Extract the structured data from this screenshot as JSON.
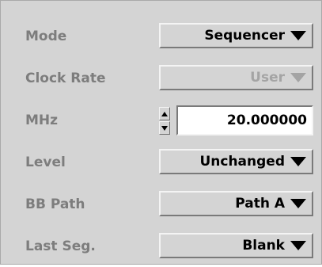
{
  "rows": [
    {
      "label": "Mode",
      "value": "Sequencer",
      "enabled": true
    },
    {
      "label": "Clock Rate",
      "value": "User",
      "enabled": false
    },
    {
      "label": "MHz",
      "value": "20.000000"
    },
    {
      "label": "Level",
      "value": "Unchanged",
      "enabled": true
    },
    {
      "label": "BB Path",
      "value": "Path A",
      "enabled": true
    },
    {
      "label": "Last Seg.",
      "value": "Blank",
      "enabled": true
    }
  ],
  "icons": {
    "dropdown_arrow": "triangle-down",
    "spin_up": "triangle-up",
    "spin_down": "triangle-down"
  },
  "colors": {
    "panel_bg": "#d4d4d4",
    "label_text": "#7d7d7d",
    "value_text": "#000000",
    "disabled_text": "#a4a4a4",
    "field_bg": "#ffffff"
  }
}
